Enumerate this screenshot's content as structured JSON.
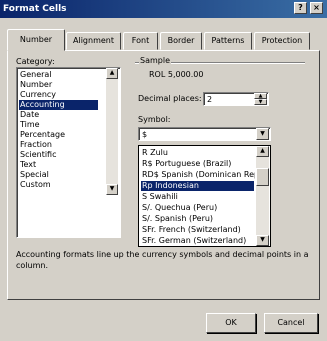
{
  "window": {
    "title": "Format Cells",
    "help_button": "?",
    "close_button": "×"
  },
  "tabs": [
    {
      "label": "Number",
      "active": true
    },
    {
      "label": "Alignment",
      "active": false
    },
    {
      "label": "Font",
      "active": false
    },
    {
      "label": "Border",
      "active": false
    },
    {
      "label": "Patterns",
      "active": false
    },
    {
      "label": "Protection",
      "active": false
    }
  ],
  "category": {
    "label": "Category:",
    "items": [
      "General",
      "Number",
      "Currency",
      "Accounting",
      "Date",
      "Time",
      "Percentage",
      "Fraction",
      "Scientific",
      "Text",
      "Special",
      "Custom"
    ],
    "selected": "Accounting"
  },
  "sample": {
    "label": "Sample",
    "value": "ROL 5,000.00"
  },
  "decimal": {
    "label": "Decimal places:",
    "value": "2"
  },
  "symbol": {
    "label": "Symbol:",
    "value": "$",
    "options": [
      "R Zulu",
      "R$ Portuguese (Brazil)",
      "RD$ Spanish (Dominican Repub",
      "Rp Indonesian",
      "S Swahili",
      "S/. Quechua (Peru)",
      "S/. Spanish (Peru)",
      "SFr. French (Switzerland)",
      "SFr. German (Switzerland)"
    ],
    "selected": "Rp Indonesian"
  },
  "description": "Accounting formats line up the currency symbols and decimal points in a column.",
  "buttons": {
    "ok": "OK",
    "cancel": "Cancel"
  },
  "colors": {
    "titlebar": "#0a246a",
    "selection": "#0a246a",
    "dialog": "#d4d0c8"
  }
}
